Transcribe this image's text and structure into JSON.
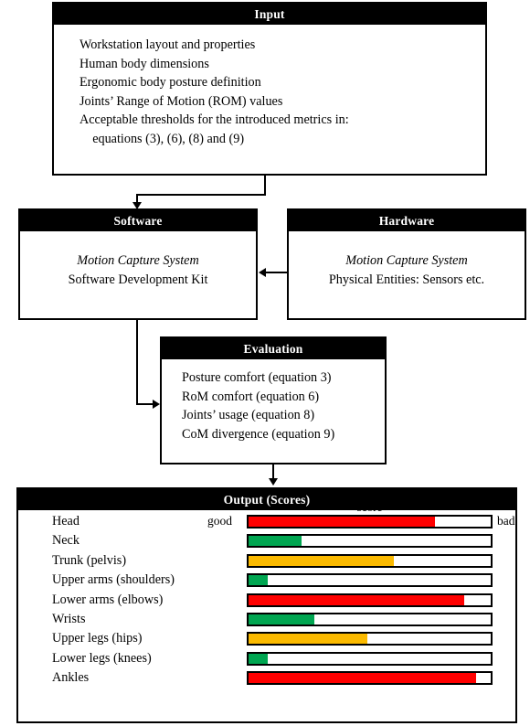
{
  "input": {
    "title": "Input",
    "lines": [
      "Workstation layout and properties",
      "Human body dimensions",
      "Ergonomic body posture definition",
      "Joints’ Range of Motion (ROM) values",
      "Acceptable thresholds for the introduced metrics in:",
      "    equations (3), (6), (8) and (9)"
    ]
  },
  "software": {
    "title": "Software",
    "line_italic": "Motion Capture System",
    "line_plain": "Software Development Kit"
  },
  "hardware": {
    "title": "Hardware",
    "line_italic": "Motion Capture System",
    "line_plain": "Physical Entities: Sensors etc."
  },
  "evaluation": {
    "title": "Evaluation",
    "lines": [
      "Posture comfort (equation 3)",
      "RoM comfort (equation 6)",
      "Joints’ usage (equation 8)",
      "CoM divergence (equation 9)"
    ]
  },
  "output": {
    "title": "Output (Scores)",
    "axis_left_label": "good",
    "axis_right_label": "bad",
    "axis_center_label": "score"
  },
  "chart_data": {
    "type": "bar",
    "title": "Output (Scores)",
    "xlabel": "score",
    "ylabel": "",
    "xlim": [
      0,
      100
    ],
    "grid": false,
    "legend": "none",
    "orientation": "horizontal",
    "axis_annotations": {
      "left": "good",
      "right": "bad",
      "center": "score"
    },
    "color_scale": {
      "green": "#00A651",
      "amber": "#FBBA00",
      "red": "#FF0000"
    },
    "categories": [
      "Head",
      "Neck",
      "Trunk (pelvis)",
      "Upper arms (shoulders)",
      "Lower arms (elbows)",
      "Wrists",
      "Upper legs (hips)",
      "Lower legs (knees)",
      "Ankles"
    ],
    "values": [
      77,
      22,
      60,
      8,
      89,
      27,
      49,
      8,
      94
    ],
    "colors": [
      "#FF0000",
      "#00A651",
      "#FBBA00",
      "#00A651",
      "#FF0000",
      "#00A651",
      "#FBBA00",
      "#00A651",
      "#FF0000"
    ]
  }
}
